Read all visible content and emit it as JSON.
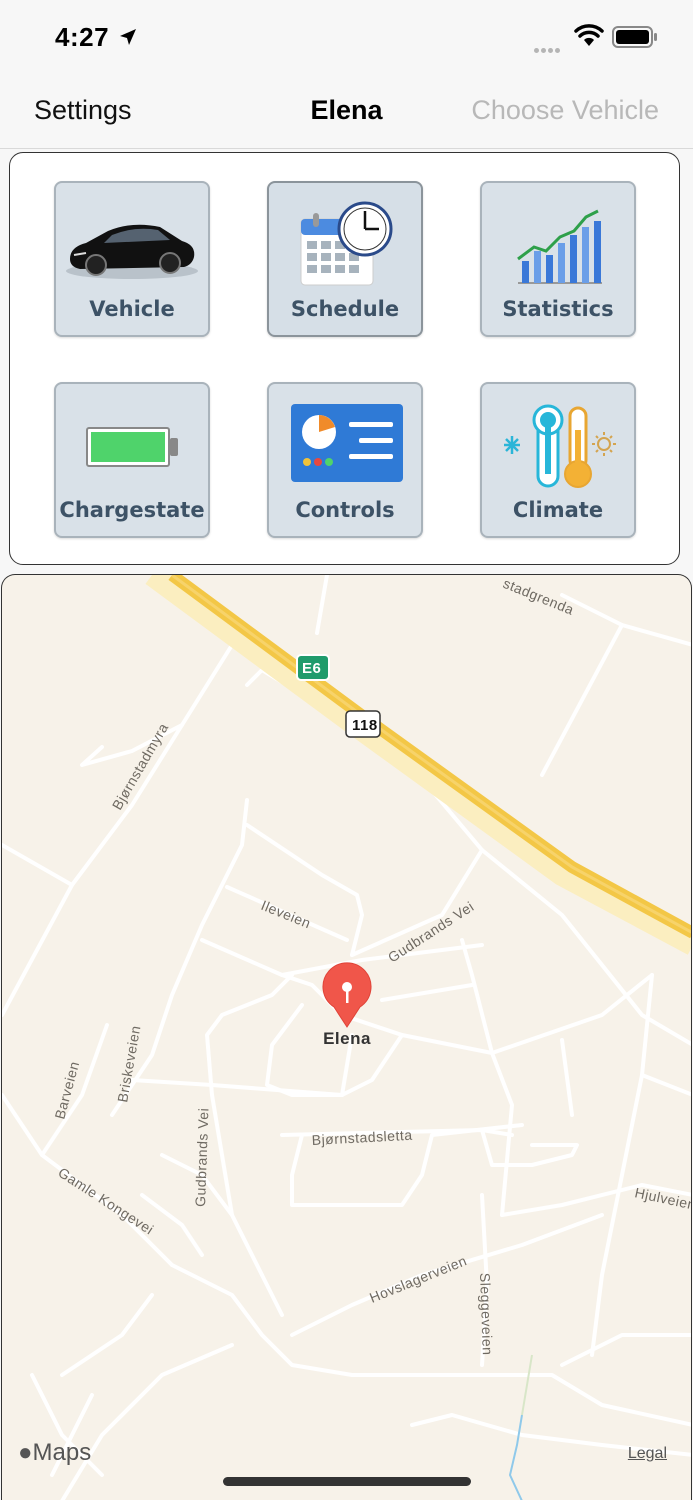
{
  "status_bar": {
    "time": "4:27"
  },
  "nav": {
    "left": "Settings",
    "title": "Elena",
    "right": "Choose Vehicle"
  },
  "tiles": [
    {
      "label": "Vehicle",
      "icon": "car-icon"
    },
    {
      "label": "Schedule",
      "icon": "calendar-clock-icon"
    },
    {
      "label": "Statistics",
      "icon": "bar-chart-icon"
    },
    {
      "label": "Chargestate",
      "icon": "battery-icon"
    },
    {
      "label": "Controls",
      "icon": "controls-icon"
    },
    {
      "label": "Climate",
      "icon": "thermometer-icon"
    }
  ],
  "map": {
    "pin_label": "Elena",
    "roads": {
      "e6": "E6",
      "r118": "118",
      "stadgrenda": "stadgrenda",
      "bjornstadmyra": "Bjørnstadmyra",
      "ileveien": "Ileveien",
      "gudbrands_vei_1": "Gudbrands Vei",
      "gudbrands_vei_2": "Gudbrands Vei",
      "briskeveien": "Briskeveien",
      "barveien": "Barveien",
      "bjornstadsletta": "Bjørnstadsletta",
      "gamle_kongevei": "Gamle Kongevei",
      "hjulveien": "Hjulveien",
      "hovslagerveien": "Hovslagerveien",
      "sleggeveien": "Sleggeveien"
    },
    "logo": "Maps",
    "legal": "Legal"
  },
  "colors": {
    "tile_bg": "#d9e1e8",
    "tile_label": "#3d5266",
    "map_bg": "#f7f2e9",
    "highway": "#f6c744",
    "pin": "#f0564a"
  }
}
